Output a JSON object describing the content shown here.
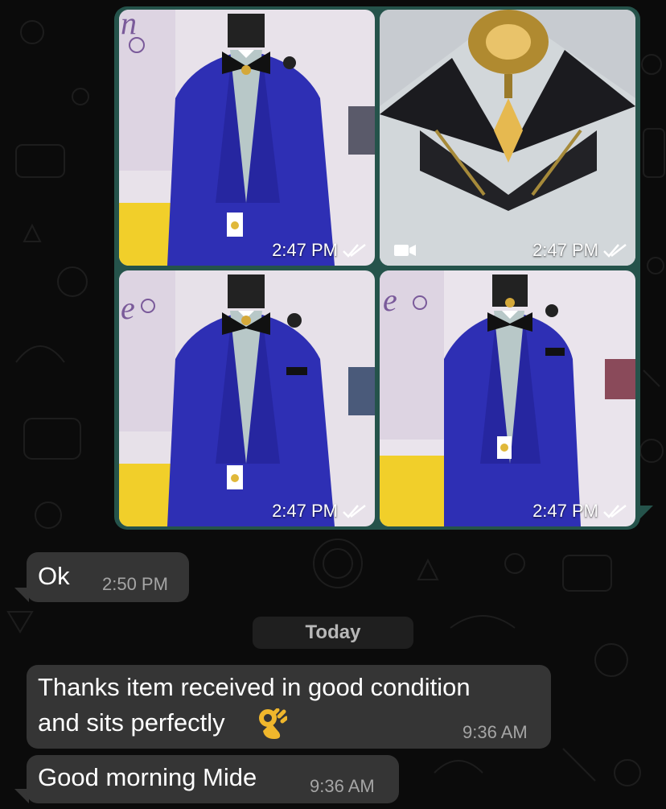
{
  "album": {
    "items": [
      {
        "time": "2:47 PM",
        "kind": "photo",
        "view": "suit-front"
      },
      {
        "time": "2:47 PM",
        "kind": "video",
        "view": "brooch-closeup"
      },
      {
        "time": "2:47 PM",
        "kind": "photo",
        "view": "suit-front-pocket"
      },
      {
        "time": "2:47 PM",
        "kind": "photo",
        "view": "suit-angle"
      }
    ],
    "status_icon": "double-check-read-icon"
  },
  "messages": [
    {
      "text": "Ok",
      "time": "2:50 PM"
    },
    {
      "text": "Thanks item received in good condition\nand sits perfectly 👌",
      "line1": "Thanks item received in good condition",
      "line2": "and sits perfectly",
      "emoji": "ok-hand-emoji",
      "time": "9:36 AM"
    },
    {
      "text": "Good morning Mide",
      "time": "9:36 AM"
    }
  ],
  "date_divider": "Today",
  "colors": {
    "background": "#0b0b0b",
    "outgoing_bubble": "#25534b",
    "incoming_bubble": "#353535",
    "suit_blue": "#2e2fb4"
  }
}
